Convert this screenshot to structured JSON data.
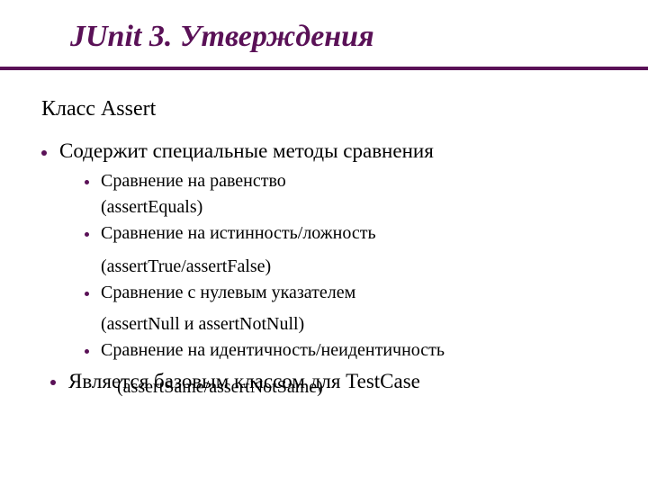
{
  "title": "JUnit 3. Утверждения",
  "subtitle": "Класс Assert",
  "b1": {
    "item1": "Содержит специальные методы сравнения",
    "item2": "Является базовым классом для TestCase"
  },
  "b2": {
    "i1_text": "Сравнение на равенство",
    "i1_method": "(assertEquals)",
    "i2_text": "Сравнение на истинность/ложность",
    "i2_method": "(assertTrue/assertFalse)",
    "i3_text": "Сравнение с нулевым указателем",
    "i3_method": "(assertNull и assertNotNull)",
    "i4_text": "Сравнение на идентичность/неидентичность",
    "i4_method": "(assertSame/assertNotSame)"
  }
}
